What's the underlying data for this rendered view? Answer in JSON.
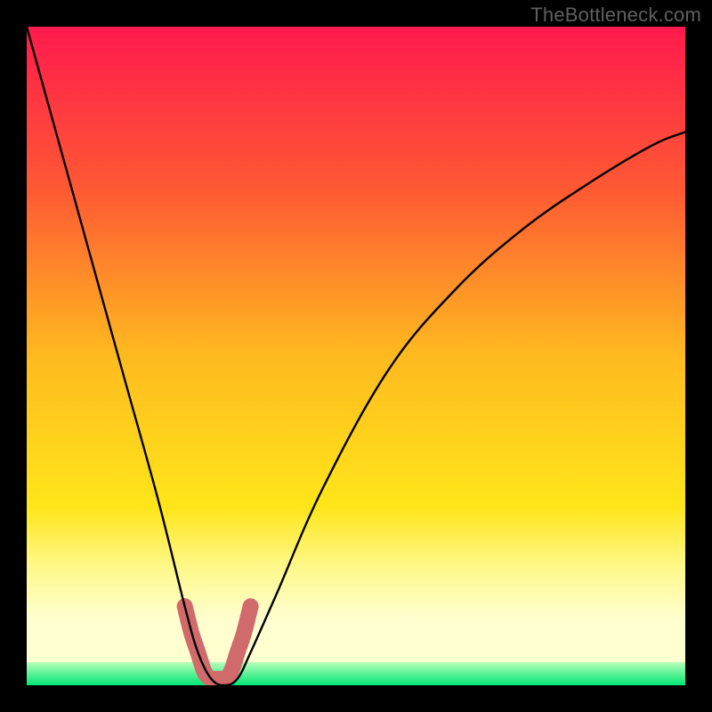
{
  "watermark": "TheBottleneck.com",
  "chart_data": {
    "type": "line",
    "title": "",
    "xlabel": "",
    "ylabel": "",
    "xlim": [
      0,
      100
    ],
    "ylim": [
      0,
      100
    ],
    "series": [
      {
        "name": "bottleneck-curve",
        "x": [
          0,
          5,
          10,
          15,
          20,
          24,
          26,
          28,
          30,
          32,
          34,
          38,
          45,
          55,
          65,
          75,
          85,
          95,
          100
        ],
        "y": [
          100,
          82,
          64,
          46,
          28,
          12,
          5,
          1,
          0,
          1,
          5,
          14,
          30,
          48,
          60,
          69,
          76,
          82,
          84
        ]
      }
    ],
    "highlight": {
      "name": "valley-marker",
      "x": [
        24,
        25,
        26,
        27,
        28,
        29,
        30,
        31,
        32,
        33,
        34
      ],
      "y": [
        12,
        8,
        5,
        2,
        1,
        1,
        1,
        2,
        5,
        8,
        12
      ]
    },
    "gradient_stops": [
      {
        "pos": 0.0,
        "color": "#ff1a4d"
      },
      {
        "pos": 0.25,
        "color": "#ff5a33"
      },
      {
        "pos": 0.5,
        "color": "#ffba1f"
      },
      {
        "pos": 0.73,
        "color": "#ffe61a"
      },
      {
        "pos": 0.82,
        "color": "#fff88a"
      },
      {
        "pos": 0.9,
        "color": "#ffffd0"
      }
    ],
    "green_band": {
      "from": 0.965,
      "to": 1.0,
      "color_top": "#b8ffb8",
      "color_bottom": "#00e676"
    }
  }
}
